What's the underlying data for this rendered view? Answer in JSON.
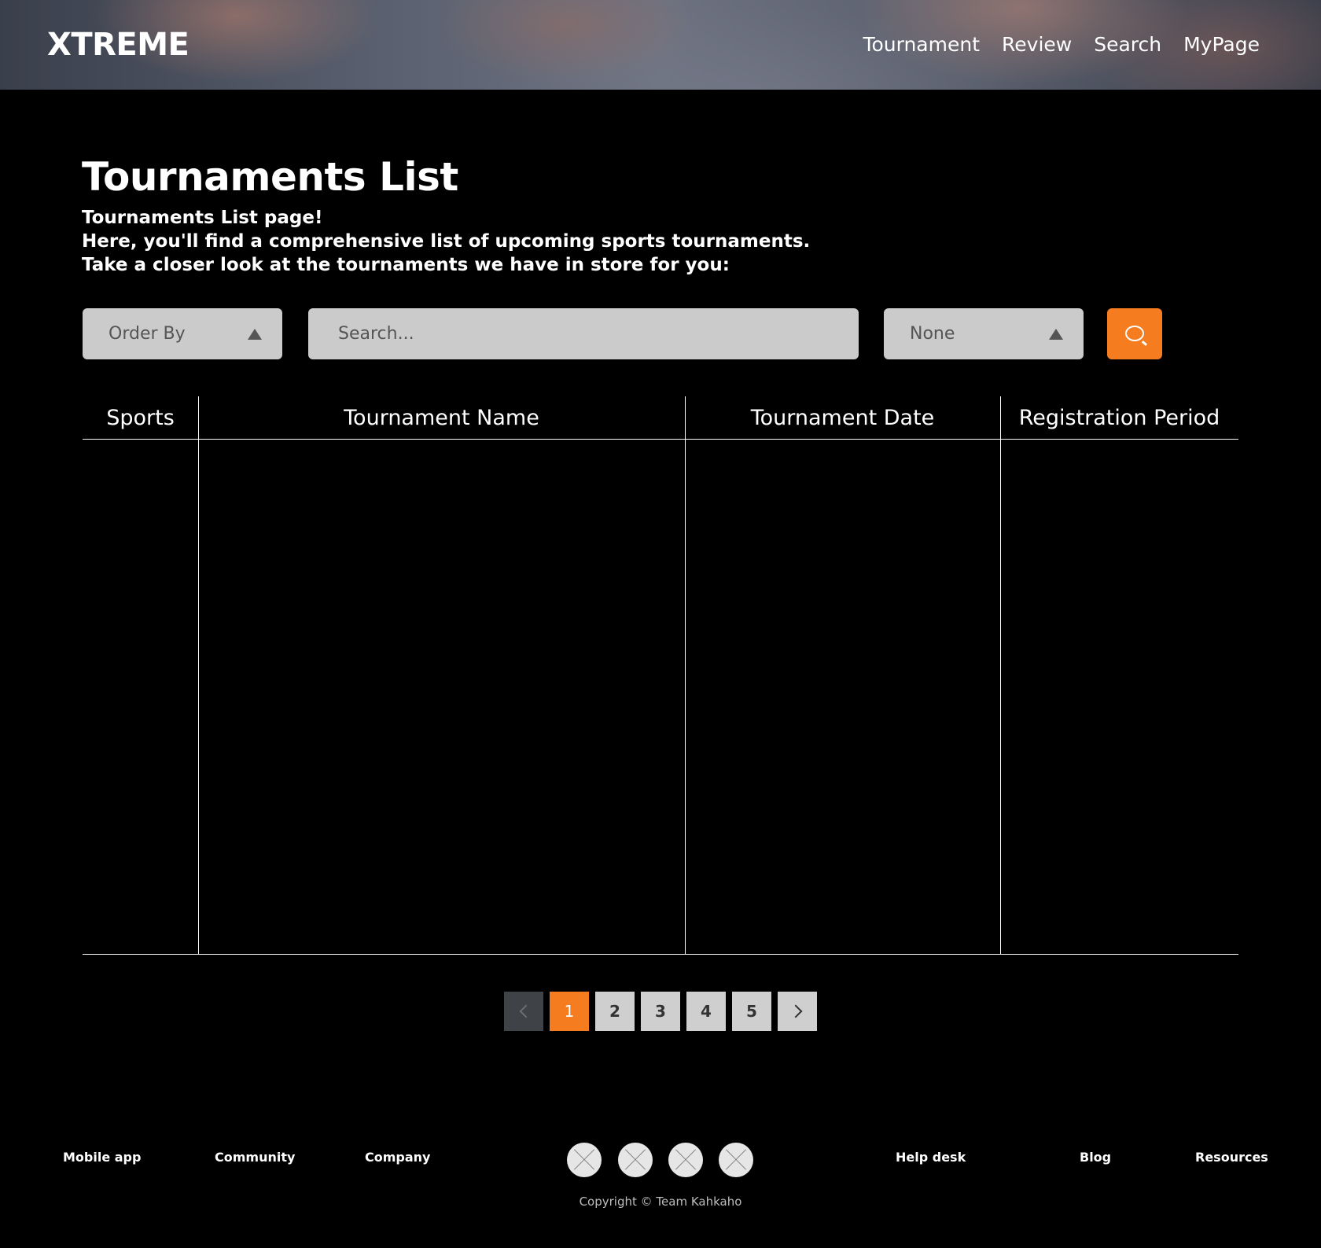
{
  "header": {
    "logo": "XTREME",
    "nav": [
      "Tournament",
      "Review",
      "Search",
      "MyPage"
    ]
  },
  "main": {
    "title": "Tournaments List",
    "intro": [
      "Tournaments List page!",
      "Here, you'll find a comprehensive list of upcoming sports tournaments.",
      "Take a closer look at the tournaments we have in store for you:"
    ]
  },
  "controls": {
    "order_by": "Order By",
    "search_placeholder": "Search...",
    "filter": "None",
    "search_button_icon": "search-icon"
  },
  "table": {
    "columns": [
      "Sports",
      "Tournament Name",
      "Tournament Date",
      "Registration Period"
    ],
    "rows": []
  },
  "pagination": {
    "pages": [
      "1",
      "2",
      "3",
      "4",
      "5"
    ],
    "current": "1",
    "prev_icon": "chevron-left-icon",
    "next_icon": "chevron-right-icon"
  },
  "footer": {
    "links_left": [
      "Mobile app",
      "Community",
      "Company"
    ],
    "links_right": [
      "Help desk",
      "Blog",
      "Resources"
    ],
    "social_icons": [
      "social-icon",
      "social-icon",
      "social-icon",
      "social-icon"
    ],
    "copyright": "Copyright © Team Kahkaho"
  },
  "colors": {
    "accent": "#f57c1f",
    "background": "#000000",
    "control_bg": "#cbcbcb"
  }
}
